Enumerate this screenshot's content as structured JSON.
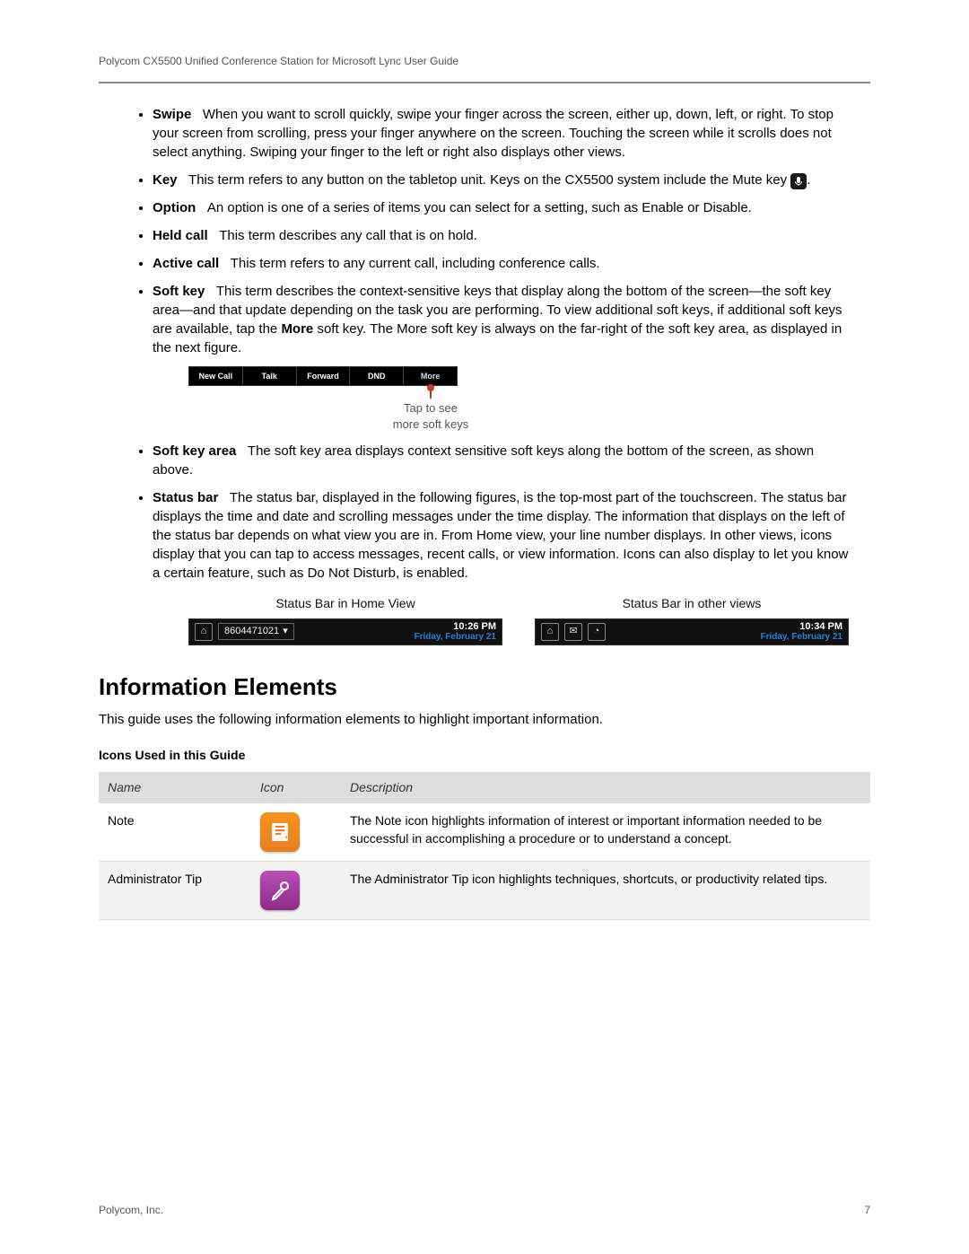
{
  "header": {
    "title": "Polycom CX5500 Unified Conference Station for Microsoft Lync User Guide"
  },
  "definitions": [
    {
      "term": "Swipe",
      "text": "When you want to scroll quickly, swipe your finger across the screen, either up, down, left, or right. To stop your screen from scrolling, press your finger anywhere on the screen. Touching the screen while it scrolls does not select anything. Swiping your finger to the left or right also displays other views."
    },
    {
      "term": "Key",
      "text_before": "This term refers to any button on the tabletop unit. Keys on the CX5500 system include the Mute key",
      "text_after": "."
    },
    {
      "term": "Option",
      "text": "An option is one of a series of items you can select for a setting, such as Enable or Disable."
    },
    {
      "term": "Held call",
      "text": "This term describes any call that is on hold."
    },
    {
      "term": "Active call",
      "text": "This term refers to any current call, including conference calls."
    },
    {
      "term": "Soft key",
      "text_before": "This term describes the context-sensitive keys that display along the bottom of the screen—the soft key area—and that update depending on the task you are performing. To view additional soft keys, if additional soft keys are available, tap the ",
      "bold_mid": "More",
      "text_after": " soft key. The More soft key is always on the far-right of the soft key area, as displayed in the next figure."
    },
    {
      "term": "Soft key area",
      "text": "The soft key area displays context sensitive soft keys along the bottom of the screen, as shown above."
    },
    {
      "term": "Status bar",
      "text": "The status bar, displayed in the following figures, is the top-most part of the touchscreen. The status bar displays the time and date and scrolling messages under the time display. The information that displays on the left of the status bar depends on what view you are in. From Home view, your line number displays. In other views, icons display that you can tap to access messages, recent calls, or view information. Icons can also display to let you know a certain feature, such as Do Not Disturb, is enabled."
    }
  ],
  "softkey_bar": {
    "keys": [
      "New Call",
      "Talk",
      "Forward",
      "DND",
      "More"
    ],
    "caption_line1": "Tap to see",
    "caption_line2": "more soft keys"
  },
  "status_bars": {
    "caption_left": "Status Bar in Home View",
    "caption_right": "Status Bar in other views",
    "left": {
      "line": "8604471021",
      "time": "10:26 PM",
      "date": "Friday, February 21"
    },
    "right": {
      "time": "10:34 PM",
      "date": "Friday, February 21"
    }
  },
  "section": {
    "title": "Information Elements",
    "intro": "This guide uses the following information elements to highlight important information.",
    "table_title": "Icons Used in this Guide"
  },
  "icons_table": {
    "headers": [
      "Name",
      "Icon",
      "Description"
    ],
    "rows": [
      {
        "name": "Note",
        "icon": "note-icon",
        "desc": "The Note icon highlights information of interest or important information needed to be successful in accomplishing a procedure or to understand a concept."
      },
      {
        "name": "Administrator Tip",
        "icon": "admin-tip-icon",
        "desc": "The Administrator Tip icon highlights techniques, shortcuts, or productivity related tips."
      }
    ]
  },
  "footer": {
    "left": "Polycom, Inc.",
    "right": "7"
  }
}
